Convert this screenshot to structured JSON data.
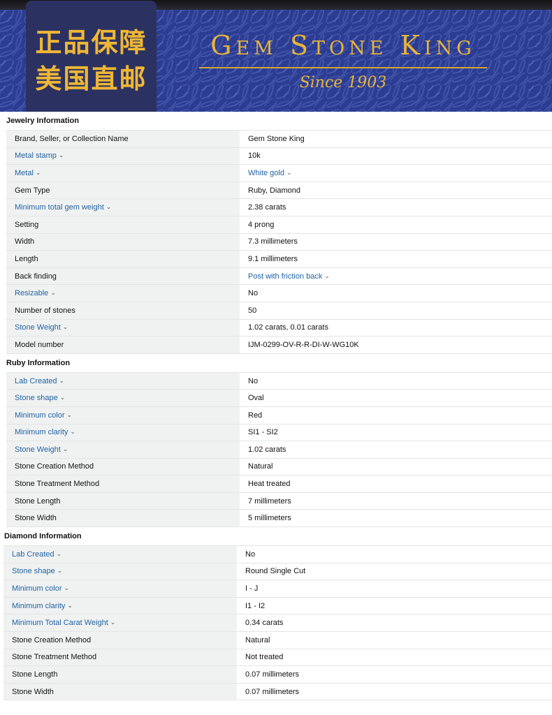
{
  "banner": {
    "badge_line1": "正品保障",
    "badge_line2": "美国直邮",
    "brand_name": "Gem Stone King",
    "since": "Since 1903"
  },
  "colors": {
    "banner_blue": "#2c3c92",
    "badge_bg": "#2b3262",
    "gold": "#e8b43a",
    "link_blue": "#2162a1",
    "key_bg": "#f0f2f2"
  },
  "jewelry": {
    "title": "Jewelry Information",
    "rows": [
      {
        "label": "Brand, Seller, or Collection Name",
        "value": "Gem Stone King"
      },
      {
        "label": "Metal stamp",
        "value": "10k"
      },
      {
        "label": "Metal",
        "value": "White gold"
      },
      {
        "label": "Gem Type",
        "value": "Ruby, Diamond"
      },
      {
        "label": "Minimum total gem weight",
        "value": "2.38 carats"
      },
      {
        "label": "Setting",
        "value": "4 prong"
      },
      {
        "label": "Width",
        "value": "7.3 millimeters"
      },
      {
        "label": "Length",
        "value": "9.1 millimeters"
      },
      {
        "label": "Back finding",
        "value": "Post with friction back"
      },
      {
        "label": "Resizable",
        "value": "No"
      },
      {
        "label": "Number of stones",
        "value": "50"
      },
      {
        "label": "Stone Weight",
        "value": "1.02 carats, 0.01 carats"
      },
      {
        "label": "Model number",
        "value": "IJM-0299-OV-R-R-DI-W-WG10K"
      }
    ]
  },
  "ruby": {
    "title": "Ruby Information",
    "rows": [
      {
        "label": "Lab Created",
        "value": "No"
      },
      {
        "label": "Stone shape",
        "value": "Oval"
      },
      {
        "label": "Minimum color",
        "value": "Red"
      },
      {
        "label": "Minimum clarity",
        "value": "SI1 - SI2"
      },
      {
        "label": "Stone Weight",
        "value": "1.02 carats"
      },
      {
        "label": "Stone Creation Method",
        "value": "Natural"
      },
      {
        "label": "Stone Treatment Method",
        "value": "Heat treated"
      },
      {
        "label": "Stone Length",
        "value": "7 millimeters"
      },
      {
        "label": "Stone Width",
        "value": "5 millimeters"
      }
    ]
  },
  "diamond": {
    "title": "Diamond Information",
    "rows": [
      {
        "label": "Lab Created",
        "value": "No"
      },
      {
        "label": "Stone shape",
        "value": "Round Single Cut"
      },
      {
        "label": "Minimum color",
        "value": "I - J"
      },
      {
        "label": "Minimum clarity",
        "value": "I1 - I2"
      },
      {
        "label": "Minimum Total Carat Weight",
        "value": "0.34 carats"
      },
      {
        "label": "Stone Creation Method",
        "value": "Natural"
      },
      {
        "label": "Stone Treatment Method",
        "value": "Not treated"
      },
      {
        "label": "Stone Length",
        "value": "0.07 millimeters"
      },
      {
        "label": "Stone Width",
        "value": "0.07 millimeters"
      }
    ]
  }
}
